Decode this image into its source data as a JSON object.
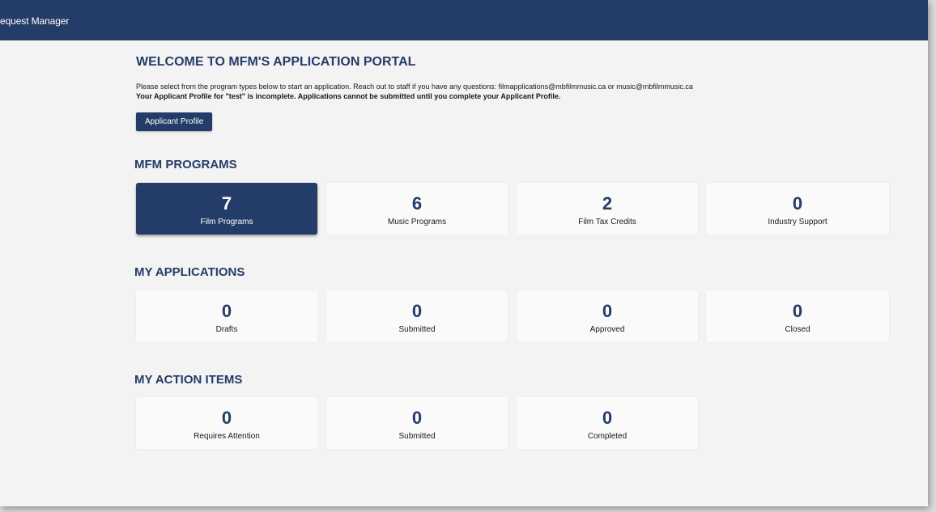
{
  "app": {
    "title": "equest Manager"
  },
  "welcome": {
    "title": "WELCOME TO MFM'S APPLICATION PORTAL",
    "intro": "Please select from the program types below to start an application. Reach out to staff if you have any questions: filmapplications@mbfilmmusic.ca or music@mbfilmmusic.ca",
    "warning": "Your Applicant Profile for \"test\" is incomplete. Applications cannot be submitted until you complete your Applicant Profile.",
    "profile_button": "Applicant Profile"
  },
  "programs": {
    "title": "MFM PROGRAMS",
    "cards": [
      {
        "count": "7",
        "label": "Film Programs",
        "active": true
      },
      {
        "count": "6",
        "label": "Music Programs",
        "active": false
      },
      {
        "count": "2",
        "label": "Film Tax Credits",
        "active": false
      },
      {
        "count": "0",
        "label": "Industry Support",
        "active": false
      }
    ]
  },
  "applications": {
    "title": "MY APPLICATIONS",
    "cards": [
      {
        "count": "0",
        "label": "Drafts"
      },
      {
        "count": "0",
        "label": "Submitted"
      },
      {
        "count": "0",
        "label": "Approved"
      },
      {
        "count": "0",
        "label": "Closed"
      }
    ]
  },
  "action_items": {
    "title": "MY ACTION ITEMS",
    "cards": [
      {
        "count": "0",
        "label": "Requires Attention"
      },
      {
        "count": "0",
        "label": "Submitted"
      },
      {
        "count": "0",
        "label": "Completed"
      }
    ]
  },
  "colors": {
    "brand": "#243c68",
    "background": "#f3f3f3",
    "card": "#fafafa"
  }
}
